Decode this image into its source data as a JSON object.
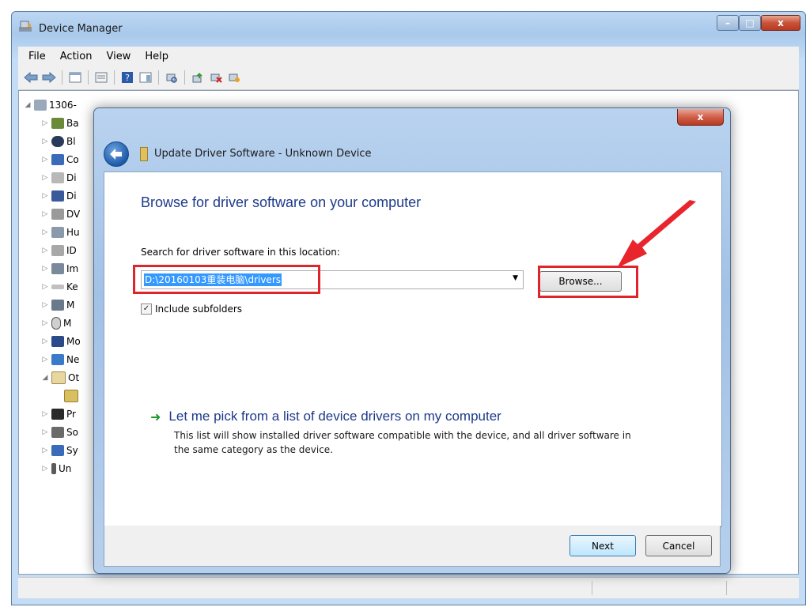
{
  "window": {
    "title": "Device Manager",
    "controls": {
      "minimize": "–",
      "maximize": "□",
      "close": "x"
    }
  },
  "menu": [
    "File",
    "Action",
    "View",
    "Help"
  ],
  "toolbar": {
    "icons": [
      "back-arrow-icon",
      "forward-arrow-icon",
      "show-hide-console-tree-icon",
      "properties-icon",
      "help-icon",
      "action-pane-icon",
      "scan-hardware-icon",
      "update-driver-icon",
      "uninstall-icon",
      "disable-icon"
    ]
  },
  "tree": {
    "root": "1306-",
    "children": [
      "Ba",
      "Bl",
      "Co",
      "Di",
      "Di",
      "DV",
      "Hu",
      "ID",
      "Im",
      "Ke",
      "M",
      "M",
      "Mo",
      "Ne",
      "Ot",
      "",
      "Pr",
      "So",
      "Sy",
      "Un"
    ]
  },
  "dialog": {
    "close_label": "x",
    "title": "Update Driver Software - Unknown Device",
    "heading": "Browse for driver software on your computer",
    "search_label": "Search for driver software in this location:",
    "path_value": "D:\\20160103重装电脑\\drivers",
    "browse_label": "Browse...",
    "include_subfolders_label": "Include subfolders",
    "include_subfolders_checked": true,
    "pick_title": "Let me pick from a list of device drivers on my computer",
    "pick_description": "This list will show installed driver software compatible with the device, and all driver software in the same category as the device.",
    "next_label": "Next",
    "cancel_label": "Cancel"
  },
  "colors": {
    "heading": "#1e3a8a",
    "highlight_box": "#e0242c",
    "selection": "#3399ff",
    "link_arrow": "#1a9a2a"
  }
}
